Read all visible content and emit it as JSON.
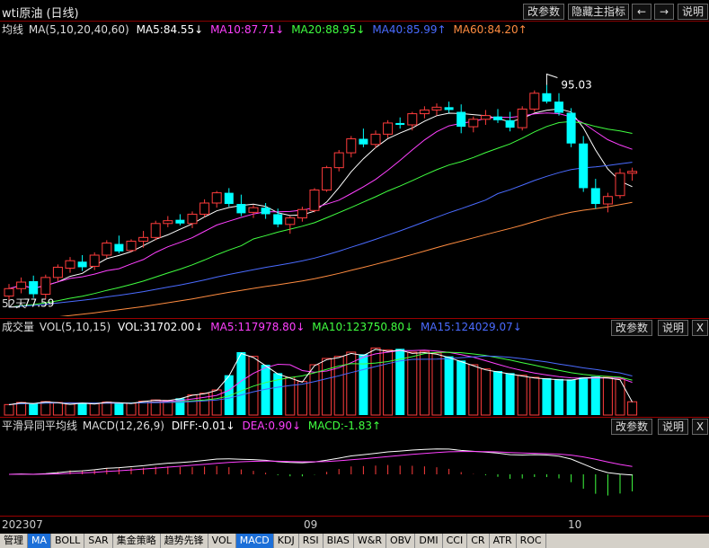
{
  "header": {
    "title": "wti原油 (日线)",
    "buttons": [
      "改参数",
      "隐藏主指标",
      "←",
      "→",
      "说明"
    ]
  },
  "price_legend": {
    "name": "均线",
    "params": "MA(5,10,20,40,60)",
    "items": [
      {
        "label": "MA5:84.55↓",
        "color": "#ffffff"
      },
      {
        "label": "MA10:87.71↓",
        "color": "#ff40ff"
      },
      {
        "label": "MA20:88.95↓",
        "color": "#40ff40"
      },
      {
        "label": "MA40:85.99↑",
        "color": "#4a6bff"
      },
      {
        "label": "MA60:84.20↑",
        "color": "#ff8c40"
      }
    ],
    "high_label": "95.03",
    "low_label": "77.59",
    "period_label": "52天"
  },
  "volume_legend": {
    "name": "成交量",
    "params": "VOL(5,10,15)",
    "items": [
      {
        "label": "VOL:31702.00↓",
        "color": "#ffffff"
      },
      {
        "label": "MA5:117978.80↓",
        "color": "#ff40ff"
      },
      {
        "label": "MA10:123750.80↓",
        "color": "#40ff40"
      },
      {
        "label": "MA15:124029.07↓",
        "color": "#4a6bff"
      }
    ],
    "buttons": [
      "改参数",
      "说明",
      "X"
    ]
  },
  "macd_legend": {
    "name": "平滑异同平均线",
    "params": "MACD(12,26,9)",
    "items": [
      {
        "label": "DIFF:-0.01↓",
        "color": "#ffffff"
      },
      {
        "label": "DEA:0.90↓",
        "color": "#ff40ff"
      },
      {
        "label": "MACD:-1.83↑",
        "color": "#40ff40"
      }
    ],
    "buttons": [
      "改参数",
      "说明",
      "X"
    ]
  },
  "x_axis": {
    "labels": [
      "202307",
      "09",
      "10"
    ]
  },
  "tabs": {
    "items": [
      "管理",
      "MA",
      "BOLL",
      "SAR",
      "集金策略",
      "趋势先锋",
      "VOL",
      "MACD",
      "KDJ",
      "RSI",
      "BIAS",
      "W&R",
      "OBV",
      "DMI",
      "CCI",
      "CR",
      "ATR",
      "ROC"
    ],
    "active": [
      "MA",
      "MACD"
    ]
  },
  "chart_data": {
    "type": "candlestick",
    "price_range": [
      72,
      100
    ],
    "candles": [
      {
        "o": 73.2,
        "h": 74.5,
        "l": 72.8,
        "c": 74.0
      },
      {
        "o": 74.0,
        "h": 75.2,
        "l": 73.5,
        "c": 74.7
      },
      {
        "o": 74.8,
        "h": 75.4,
        "l": 73.0,
        "c": 73.4
      },
      {
        "o": 73.4,
        "h": 75.5,
        "l": 72.9,
        "c": 75.2
      },
      {
        "o": 75.2,
        "h": 76.6,
        "l": 74.8,
        "c": 76.3
      },
      {
        "o": 76.2,
        "h": 77.4,
        "l": 75.7,
        "c": 77.0
      },
      {
        "o": 76.9,
        "h": 77.6,
        "l": 75.9,
        "c": 76.3
      },
      {
        "o": 76.4,
        "h": 77.9,
        "l": 76.0,
        "c": 77.6
      },
      {
        "o": 77.6,
        "h": 79.2,
        "l": 77.3,
        "c": 78.9
      },
      {
        "o": 78.8,
        "h": 79.7,
        "l": 77.8,
        "c": 78.0
      },
      {
        "o": 78.1,
        "h": 79.3,
        "l": 77.9,
        "c": 79.1
      },
      {
        "o": 79.1,
        "h": 80.2,
        "l": 78.4,
        "c": 79.5
      },
      {
        "o": 79.5,
        "h": 81.3,
        "l": 79.2,
        "c": 81.0
      },
      {
        "o": 81.0,
        "h": 81.8,
        "l": 80.6,
        "c": 81.3
      },
      {
        "o": 81.4,
        "h": 82.0,
        "l": 80.8,
        "c": 81.0
      },
      {
        "o": 81.0,
        "h": 82.3,
        "l": 80.5,
        "c": 82.0
      },
      {
        "o": 82.0,
        "h": 83.6,
        "l": 81.7,
        "c": 83.2
      },
      {
        "o": 83.2,
        "h": 84.5,
        "l": 82.7,
        "c": 84.3
      },
      {
        "o": 84.3,
        "h": 84.8,
        "l": 82.8,
        "c": 83.1
      },
      {
        "o": 83.1,
        "h": 84.1,
        "l": 81.8,
        "c": 82.1
      },
      {
        "o": 82.2,
        "h": 83.0,
        "l": 81.6,
        "c": 82.7
      },
      {
        "o": 82.7,
        "h": 83.2,
        "l": 81.5,
        "c": 82.0
      },
      {
        "o": 82.0,
        "h": 82.6,
        "l": 80.6,
        "c": 80.9
      },
      {
        "o": 80.9,
        "h": 81.8,
        "l": 79.9,
        "c": 81.6
      },
      {
        "o": 81.6,
        "h": 82.8,
        "l": 81.2,
        "c": 82.5
      },
      {
        "o": 82.4,
        "h": 84.8,
        "l": 82.2,
        "c": 84.6
      },
      {
        "o": 84.6,
        "h": 87.2,
        "l": 84.4,
        "c": 87.0
      },
      {
        "o": 87.0,
        "h": 88.9,
        "l": 86.6,
        "c": 88.6
      },
      {
        "o": 88.6,
        "h": 90.4,
        "l": 88.1,
        "c": 90.1
      },
      {
        "o": 90.1,
        "h": 91.2,
        "l": 89.2,
        "c": 89.5
      },
      {
        "o": 89.5,
        "h": 91.0,
        "l": 89.1,
        "c": 90.6
      },
      {
        "o": 90.6,
        "h": 92.1,
        "l": 90.2,
        "c": 91.8
      },
      {
        "o": 91.8,
        "h": 92.4,
        "l": 91.2,
        "c": 91.6
      },
      {
        "o": 91.6,
        "h": 93.0,
        "l": 91.0,
        "c": 92.8
      },
      {
        "o": 92.8,
        "h": 93.6,
        "l": 92.3,
        "c": 93.2
      },
      {
        "o": 93.2,
        "h": 93.9,
        "l": 92.6,
        "c": 93.5
      },
      {
        "o": 93.5,
        "h": 94.1,
        "l": 92.9,
        "c": 93.2
      },
      {
        "o": 93.0,
        "h": 93.8,
        "l": 90.7,
        "c": 91.4
      },
      {
        "o": 91.4,
        "h": 92.5,
        "l": 90.8,
        "c": 92.2
      },
      {
        "o": 92.2,
        "h": 93.2,
        "l": 91.6,
        "c": 92.6
      },
      {
        "o": 92.5,
        "h": 93.3,
        "l": 91.8,
        "c": 92.1
      },
      {
        "o": 92.1,
        "h": 93.0,
        "l": 90.9,
        "c": 91.3
      },
      {
        "o": 91.3,
        "h": 93.6,
        "l": 91.0,
        "c": 93.3
      },
      {
        "o": 93.3,
        "h": 95.3,
        "l": 93.0,
        "c": 95.0
      },
      {
        "o": 95.0,
        "h": 95.9,
        "l": 93.9,
        "c": 94.1
      },
      {
        "o": 94.1,
        "h": 95.0,
        "l": 92.6,
        "c": 92.9
      },
      {
        "o": 92.9,
        "h": 93.4,
        "l": 89.2,
        "c": 89.6
      },
      {
        "o": 89.6,
        "h": 90.4,
        "l": 84.4,
        "c": 84.8
      },
      {
        "o": 84.8,
        "h": 85.8,
        "l": 82.6,
        "c": 83.1
      },
      {
        "o": 83.1,
        "h": 84.3,
        "l": 82.2,
        "c": 83.9
      },
      {
        "o": 84.0,
        "h": 86.9,
        "l": 83.7,
        "c": 86.4
      },
      {
        "o": 86.4,
        "h": 87.0,
        "l": 85.6,
        "c": 86.6
      }
    ],
    "volume_range": [
      0,
      180000
    ],
    "volumes": [
      25000,
      30000,
      28000,
      32000,
      30000,
      26000,
      29000,
      27000,
      31000,
      30000,
      28000,
      33000,
      36000,
      35000,
      40000,
      48000,
      52000,
      60000,
      95000,
      150000,
      140000,
      120000,
      100000,
      90000,
      80000,
      120000,
      135000,
      140000,
      150000,
      145000,
      160000,
      155000,
      158000,
      150000,
      152000,
      148000,
      140000,
      130000,
      120000,
      110000,
      105000,
      100000,
      95000,
      90000,
      88000,
      86000,
      85000,
      90000,
      92000,
      90000,
      86000,
      31702
    ],
    "macd_range": [
      -3,
      3
    ]
  }
}
